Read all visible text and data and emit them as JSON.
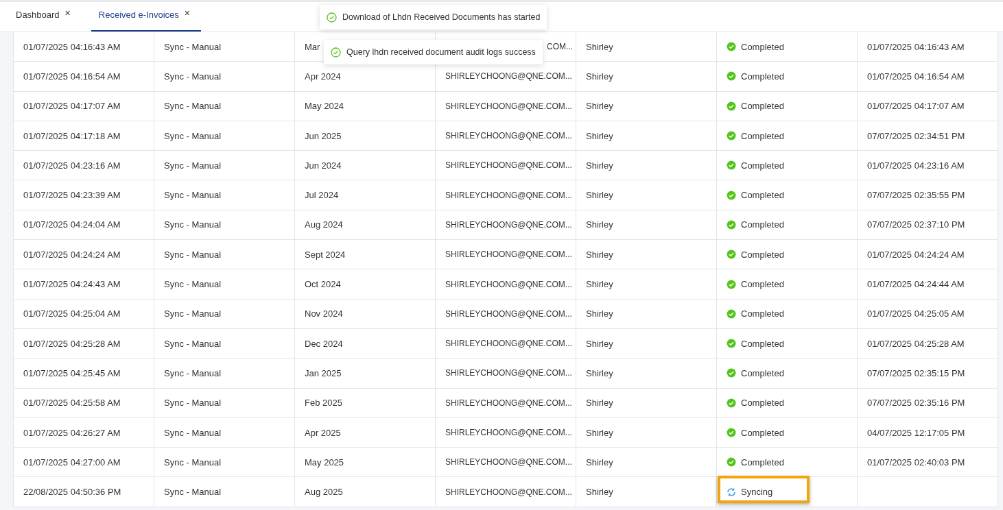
{
  "tabs": [
    {
      "label": "Dashboard",
      "close": "×",
      "selected": false
    },
    {
      "label": "Received e-Invoices",
      "close": "×",
      "selected": true
    }
  ],
  "toasts": [
    {
      "kind": "success",
      "message": "Download of Lhdn Received Documents has started"
    },
    {
      "kind": "success",
      "message": "Query lhdn received document audit logs success"
    }
  ],
  "table": {
    "rows": [
      {
        "started": "01/07/2025 04:16:43 AM",
        "type": "Sync - Manual",
        "period": "Mar",
        "user_email": "COM...",
        "user": "Shirley",
        "status": {
          "kind": "completed",
          "label": "Completed"
        },
        "finished": "01/07/2025 04:16:43 AM",
        "covered": true,
        "highlighted": false
      },
      {
        "started": "01/07/2025 04:16:54 AM",
        "type": "Sync - Manual",
        "period": "Apr 2024",
        "user_email": "SHIRLEYCHOONG@QNE.COM...",
        "user": "Shirley",
        "status": {
          "kind": "completed",
          "label": "Completed"
        },
        "finished": "01/07/2025 04:16:54 AM",
        "covered": false,
        "highlighted": false
      },
      {
        "started": "01/07/2025 04:17:07 AM",
        "type": "Sync - Manual",
        "period": "May 2024",
        "user_email": "SHIRLEYCHOONG@QNE.COM...",
        "user": "Shirley",
        "status": {
          "kind": "completed",
          "label": "Completed"
        },
        "finished": "01/07/2025 04:17:07 AM",
        "covered": false,
        "highlighted": false
      },
      {
        "started": "01/07/2025 04:17:18 AM",
        "type": "Sync - Manual",
        "period": "Jun 2025",
        "user_email": "SHIRLEYCHOONG@QNE.COM...",
        "user": "Shirley",
        "status": {
          "kind": "completed",
          "label": "Completed"
        },
        "finished": "07/07/2025 02:34:51 PM",
        "covered": false,
        "highlighted": false
      },
      {
        "started": "01/07/2025 04:23:16 AM",
        "type": "Sync - Manual",
        "period": "Jun 2024",
        "user_email": "SHIRLEYCHOONG@QNE.COM...",
        "user": "Shirley",
        "status": {
          "kind": "completed",
          "label": "Completed"
        },
        "finished": "01/07/2025 04:23:16 AM",
        "covered": false,
        "highlighted": false
      },
      {
        "started": "01/07/2025 04:23:39 AM",
        "type": "Sync - Manual",
        "period": "Jul 2024",
        "user_email": "SHIRLEYCHOONG@QNE.COM...",
        "user": "Shirley",
        "status": {
          "kind": "completed",
          "label": "Completed"
        },
        "finished": "07/07/2025 02:35:55 PM",
        "covered": false,
        "highlighted": false
      },
      {
        "started": "01/07/2025 04:24:04 AM",
        "type": "Sync - Manual",
        "period": "Aug 2024",
        "user_email": "SHIRLEYCHOONG@QNE.COM...",
        "user": "Shirley",
        "status": {
          "kind": "completed",
          "label": "Completed"
        },
        "finished": "07/07/2025 02:37:10 PM",
        "covered": false,
        "highlighted": false
      },
      {
        "started": "01/07/2025 04:24:24 AM",
        "type": "Sync - Manual",
        "period": "Sept 2024",
        "user_email": "SHIRLEYCHOONG@QNE.COM...",
        "user": "Shirley",
        "status": {
          "kind": "completed",
          "label": "Completed"
        },
        "finished": "01/07/2025 04:24:24 AM",
        "covered": false,
        "highlighted": false
      },
      {
        "started": "01/07/2025 04:24:43 AM",
        "type": "Sync - Manual",
        "period": "Oct 2024",
        "user_email": "SHIRLEYCHOONG@QNE.COM...",
        "user": "Shirley",
        "status": {
          "kind": "completed",
          "label": "Completed"
        },
        "finished": "01/07/2025 04:24:44 AM",
        "covered": false,
        "highlighted": false
      },
      {
        "started": "01/07/2025 04:25:04 AM",
        "type": "Sync - Manual",
        "period": "Nov 2024",
        "user_email": "SHIRLEYCHOONG@QNE.COM...",
        "user": "Shirley",
        "status": {
          "kind": "completed",
          "label": "Completed"
        },
        "finished": "01/07/2025 04:25:05 AM",
        "covered": false,
        "highlighted": false
      },
      {
        "started": "01/07/2025 04:25:28 AM",
        "type": "Sync - Manual",
        "period": "Dec 2024",
        "user_email": "SHIRLEYCHOONG@QNE.COM...",
        "user": "Shirley",
        "status": {
          "kind": "completed",
          "label": "Completed"
        },
        "finished": "01/07/2025 04:25:28 AM",
        "covered": false,
        "highlighted": false
      },
      {
        "started": "01/07/2025 04:25:45 AM",
        "type": "Sync - Manual",
        "period": "Jan 2025",
        "user_email": "SHIRLEYCHOONG@QNE.COM...",
        "user": "Shirley",
        "status": {
          "kind": "completed",
          "label": "Completed"
        },
        "finished": "07/07/2025 02:35:15 PM",
        "covered": false,
        "highlighted": false
      },
      {
        "started": "01/07/2025 04:25:58 AM",
        "type": "Sync - Manual",
        "period": "Feb 2025",
        "user_email": "SHIRLEYCHOONG@QNE.COM...",
        "user": "Shirley",
        "status": {
          "kind": "completed",
          "label": "Completed"
        },
        "finished": "07/07/2025 02:35:16 PM",
        "covered": false,
        "highlighted": false
      },
      {
        "started": "01/07/2025 04:26:27 AM",
        "type": "Sync - Manual",
        "period": "Apr 2025",
        "user_email": "SHIRLEYCHOONG@QNE.COM...",
        "user": "Shirley",
        "status": {
          "kind": "completed",
          "label": "Completed"
        },
        "finished": "04/07/2025 12:17:05 PM",
        "covered": false,
        "highlighted": false
      },
      {
        "started": "01/07/2025 04:27:00 AM",
        "type": "Sync - Manual",
        "period": "May 2025",
        "user_email": "SHIRLEYCHOONG@QNE.COM...",
        "user": "Shirley",
        "status": {
          "kind": "completed",
          "label": "Completed"
        },
        "finished": "01/07/2025 02:40:03 PM",
        "covered": false,
        "highlighted": false
      },
      {
        "started": "22/08/2025 04:50:36 PM",
        "type": "Sync - Manual",
        "period": "Aug 2025",
        "user_email": "SHIRLEYCHOONG@QNE.COM...",
        "user": "Shirley",
        "status": {
          "kind": "syncing",
          "label": "Syncing"
        },
        "covered": false,
        "highlighted": true
      }
    ]
  }
}
